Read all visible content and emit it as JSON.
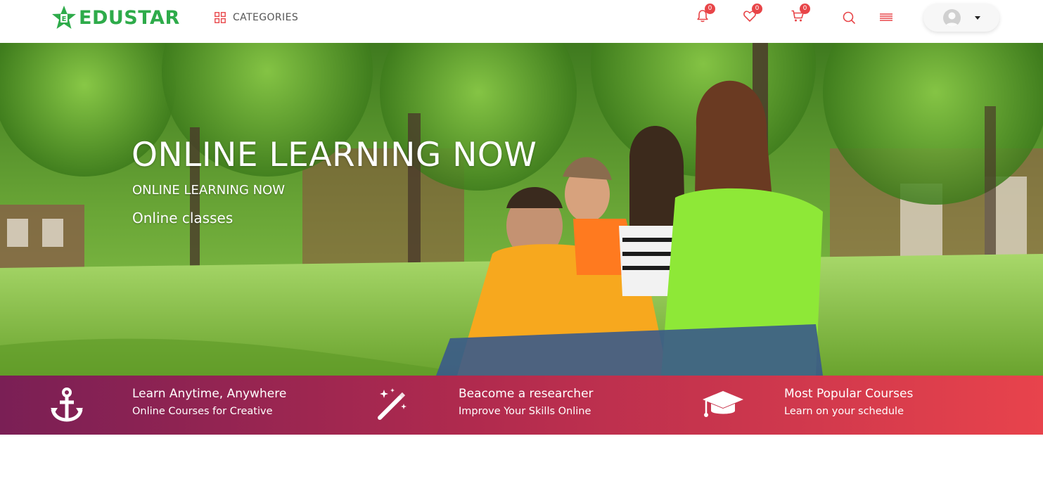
{
  "header": {
    "logo_text": "EDUSTAR",
    "categories_label": "CATEGORIES",
    "notifications_count": "0",
    "wishlist_count": "0",
    "cart_count": "0",
    "icons": [
      "bell-icon",
      "heart-icon",
      "cart-icon",
      "search-icon",
      "menu-icon",
      "avatar",
      "caret-down-icon"
    ]
  },
  "hero": {
    "title": "ONLINE LEARNING NOW",
    "subtitle": "ONLINE LEARNING NOW",
    "tagline": "Online classes"
  },
  "features": [
    {
      "icon": "anchor-icon",
      "title": "Learn Anytime, Anywhere",
      "subtitle": "Online Courses for Creative"
    },
    {
      "icon": "magic-wand-icon",
      "title": "Beacome a researcher",
      "subtitle": "Improve Your Skills Online"
    },
    {
      "icon": "graduation-cap-icon",
      "title": "Most Popular Courses",
      "subtitle": "Learn on your schedule"
    }
  ],
  "colors": {
    "brand_green": "#2eab4a",
    "accent_red": "#e84548",
    "strip_start": "#7a1f55",
    "strip_end": "#e8434c"
  }
}
